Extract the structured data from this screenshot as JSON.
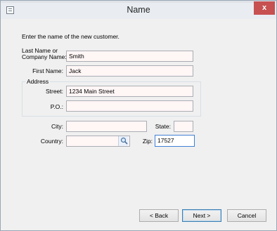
{
  "window": {
    "title": "Name",
    "close_glyph": "x"
  },
  "instruction": "Enter the name of the new customer.",
  "form": {
    "last_name_label_line1": "Last Name or",
    "last_name_label_line2": "Company Name:",
    "last_name_value": "Smith",
    "first_name_label": "First Name:",
    "first_name_value": "Jack",
    "address_group_label": "Address",
    "street_label": "Street:",
    "street_value": "1234 Main Street",
    "po_label": "P.O.:",
    "po_value": "",
    "city_label": "City:",
    "city_value": "",
    "state_label": "State:",
    "state_value": "",
    "country_label": "Country:",
    "country_value": "",
    "zip_label": "Zip:",
    "zip_value": "17527"
  },
  "buttons": {
    "back": "< Back",
    "next": "Next >",
    "cancel": "Cancel"
  },
  "icons": {
    "app": "window-icon",
    "lookup": "magnifier-icon",
    "close": "close-icon"
  }
}
